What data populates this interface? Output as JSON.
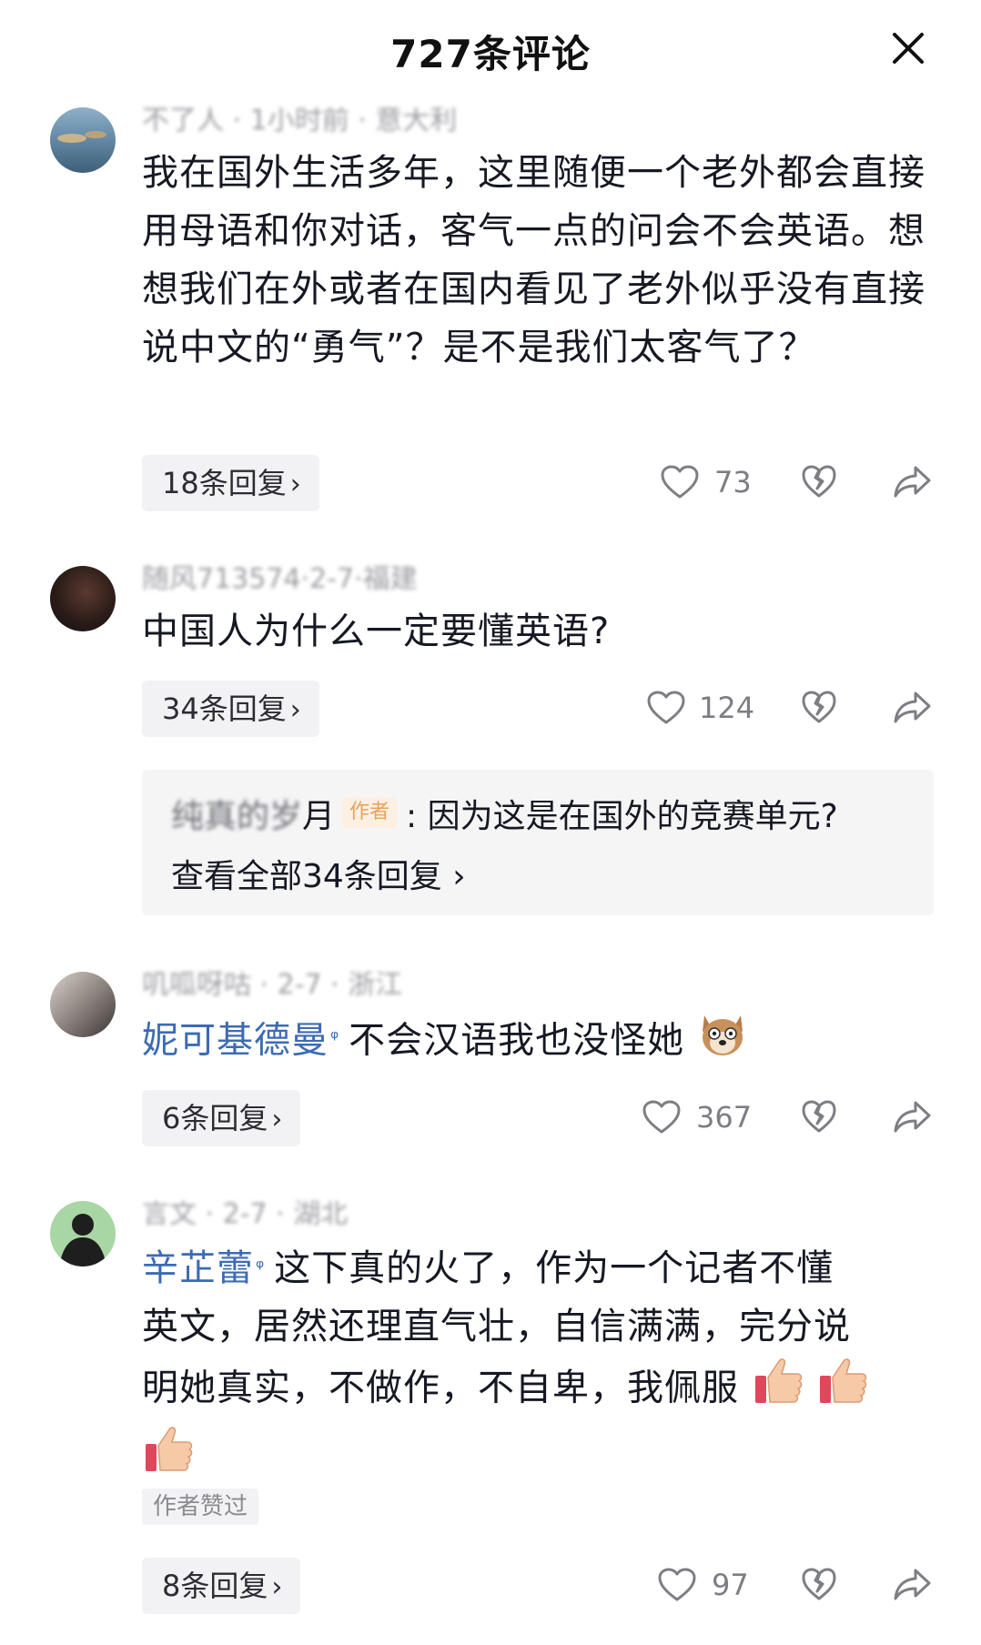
{
  "header": {
    "title": "727条评论"
  },
  "comments": [
    {
      "username": "不了人 · 1小时前 · 意大利",
      "text": "我在国外生活多年，这里随便一个老外都会直接用母语和你对话，客气一点的问会不会英语。想想我们在外或者在国内看见了老外似乎没有直接说中文的“勇气”？是不是我们太客气了？",
      "replies_label": "18条回复",
      "likes": "73"
    },
    {
      "username": "随风713574·2-7·福建",
      "text": "中国人为什么一定要懂英语?",
      "replies_label": "34条回复",
      "likes": "124",
      "sub_reply": {
        "name_blurred": "纯真的岁",
        "name_tail": "月",
        "badge": "作者",
        "text": ": 因为这是在国外的竞赛单元?",
        "view_all": "查看全部34条回复"
      }
    },
    {
      "username": "叽呱呀咕 · 2-7 · 浙江",
      "mention": "妮可基德曼",
      "text": "不会汉语我也没怪她",
      "replies_label": "6条回复",
      "likes": "367"
    },
    {
      "username": "言文 · 2-7 · 湖北",
      "mention": "辛芷蕾",
      "text_line1": "这下真的火了，作为一个记者不懂",
      "text_line2": "英文，居然还理直气壮，自信满满，完分说",
      "text_line3": "明她真实，不做作，不自卑，我佩服",
      "author_liked": "作者赞过",
      "replies_label": "8条回复",
      "likes": "97"
    }
  ],
  "icons": {
    "close": "close-icon",
    "like": "heart-icon",
    "dislike": "broken-heart-icon",
    "share": "share-arrow-icon",
    "mention": "search-icon"
  }
}
